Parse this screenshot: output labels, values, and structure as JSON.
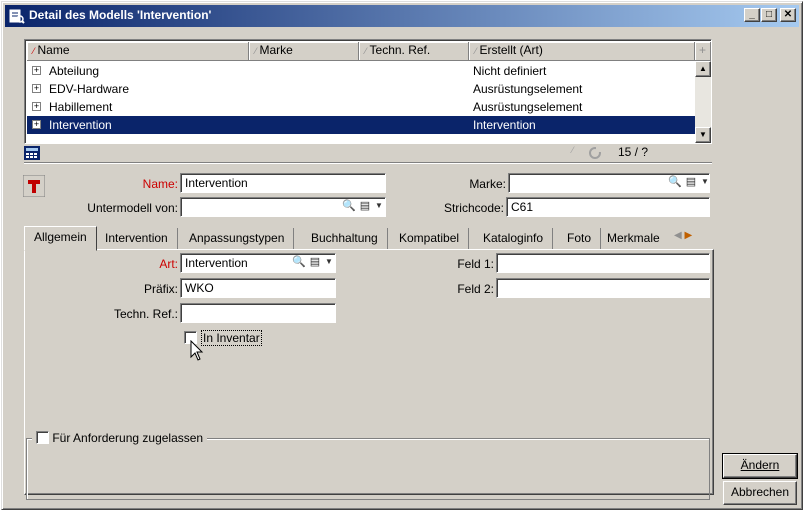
{
  "window": {
    "title": "Detail des Modells 'Intervention'"
  },
  "list": {
    "columns": [
      "Name",
      "Marke",
      "Techn. Ref.",
      "Erstellt (Art)"
    ],
    "rows": [
      {
        "name": "Abteilung",
        "art": "Nicht definiert",
        "selected": false
      },
      {
        "name": "EDV-Hardware",
        "art": "Ausrüstungselement",
        "selected": false
      },
      {
        "name": "Habillement",
        "art": "Ausrüstungselement",
        "selected": false
      },
      {
        "name": "Intervention",
        "art": "Intervention",
        "selected": true
      }
    ],
    "counter": "15 / ?"
  },
  "form": {
    "name_label": "Name:",
    "name_value": "Intervention",
    "marke_label": "Marke:",
    "marke_value": "",
    "untermodell_label": "Untermodell von:",
    "untermodell_value": "",
    "strichcode_label": "Strichcode:",
    "strichcode_value": "C61"
  },
  "tabs": [
    "Allgemein",
    "Intervention",
    "Anpassungstypen",
    "Buchhaltung",
    "Kompatibel",
    "Kataloginfo",
    "Foto",
    "Merkmale"
  ],
  "general": {
    "art_label": "Art:",
    "art_value": "Intervention",
    "praefix_label": "Präfix:",
    "praefix_value": "WKO",
    "technref_label": "Techn. Ref.:",
    "technref_value": "",
    "inventar_label": "In Inventar",
    "feld1_label": "Feld 1:",
    "feld1_value": "",
    "feld2_label": "Feld 2:",
    "feld2_value": "",
    "anforderung_label": "Für Anforderung zugelassen"
  },
  "buttons": {
    "change": "Ändern",
    "cancel": "Abbrechen"
  },
  "icons": {
    "window_icon": "model-detail-icon",
    "model_icon": "hammer-icon",
    "search": "magnifier-icon",
    "details": "details-icon"
  },
  "colors": {
    "title_start": "#0a246a",
    "title_end": "#a6caf0",
    "selection": "#0a246a",
    "required": "#cc0000",
    "face": "#d4d0c8"
  }
}
